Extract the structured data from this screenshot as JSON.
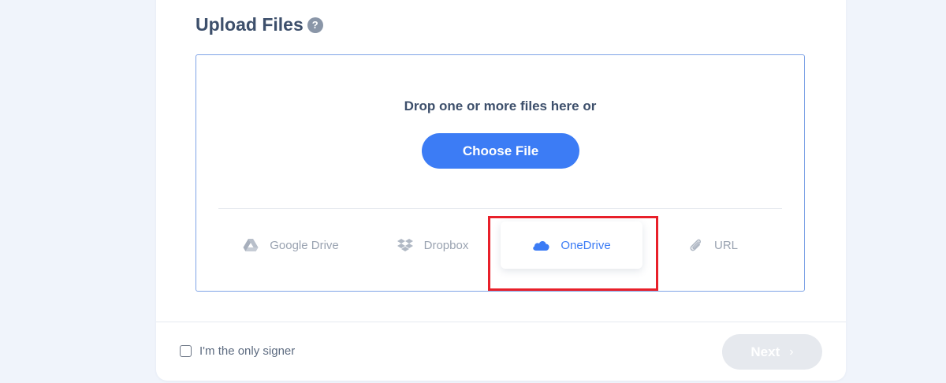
{
  "upload": {
    "title": "Upload Files",
    "help_icon": "question-icon",
    "help_glyph": "?",
    "drop_text": "Drop one or more files here or",
    "choose_label": "Choose File"
  },
  "sources": [
    {
      "label": "Google Drive",
      "icon": "google-drive-icon",
      "active": false
    },
    {
      "label": "Dropbox",
      "icon": "dropbox-icon",
      "active": false
    },
    {
      "label": "OneDrive",
      "icon": "onedrive-icon",
      "active": true
    },
    {
      "label": "URL",
      "icon": "paperclip-icon",
      "active": false
    }
  ],
  "footer": {
    "signer_label": "I'm the only signer",
    "signer_checked": false,
    "next_label": "Next",
    "next_icon": "chevron-right-icon",
    "next_glyph": "›"
  },
  "colors": {
    "accent": "#3c7cf5",
    "title": "#3d4f6b",
    "muted": "#9aa3b1",
    "highlight": "#e8202a"
  }
}
